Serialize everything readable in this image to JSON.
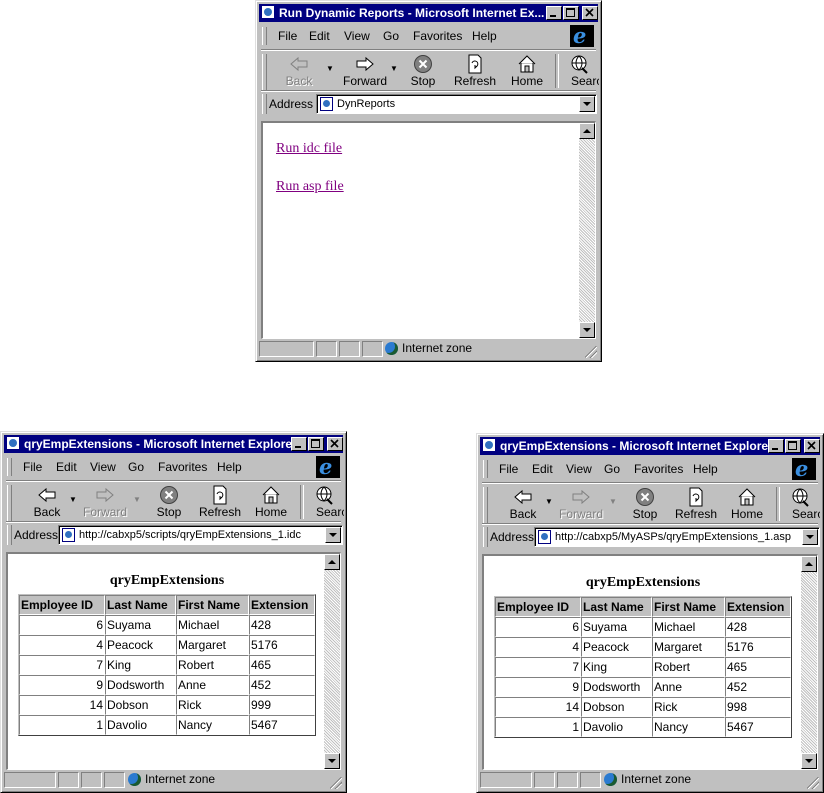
{
  "windows": {
    "dyn": {
      "title": "Run Dynamic Reports - Microsoft Internet Ex...",
      "address": "DynReports",
      "links": [
        "Run idc file",
        "Run asp file"
      ]
    },
    "idc": {
      "title": "qryEmpExtensions - Microsoft Internet Explorer",
      "address": "http://cabxp5/scripts/qryEmpExtensions_1.idc",
      "report_title": "qryEmpExtensions"
    },
    "asp": {
      "title": "qryEmpExtensions - Microsoft Internet Explorer",
      "address": "http://cabxp5/MyASPs/qryEmpExtensions_1.asp",
      "report_title": "qryEmpExtensions"
    }
  },
  "menu": [
    "File",
    "Edit",
    "View",
    "Go",
    "Favorites",
    "Help"
  ],
  "toolbar": {
    "back": "Back",
    "forward": "Forward",
    "stop": "Stop",
    "refresh": "Refresh",
    "home": "Home",
    "search": "Searc"
  },
  "address_label": "Address",
  "status": {
    "zone": "Internet zone"
  },
  "table_headers": [
    "Employee ID",
    "Last Name",
    "First Name",
    "Extension"
  ],
  "idc_rows": [
    [
      "6",
      "Suyama",
      "Michael",
      "428"
    ],
    [
      "4",
      "Peacock",
      "Margaret",
      "5176"
    ],
    [
      "7",
      "King",
      "Robert",
      "465"
    ],
    [
      "9",
      "Dodsworth",
      "Anne",
      "452"
    ],
    [
      "14",
      "Dobson",
      "Rick",
      "999"
    ],
    [
      "1",
      "Davolio",
      "Nancy",
      "5467"
    ]
  ],
  "asp_rows": [
    [
      "6",
      "Suyama",
      "Michael",
      "428"
    ],
    [
      "4",
      "Peacock",
      "Margaret",
      "5176"
    ],
    [
      "7",
      "King",
      "Robert",
      "465"
    ],
    [
      "9",
      "Dodsworth",
      "Anne",
      "452"
    ],
    [
      "14",
      "Dobson",
      "Rick",
      "998"
    ],
    [
      "1",
      "Davolio",
      "Nancy",
      "5467"
    ]
  ],
  "colors": {
    "titlebar": "#000080",
    "chrome": "#c0c0c0",
    "visited_link": "#800080",
    "ie_logo": "#3a8fe0"
  }
}
